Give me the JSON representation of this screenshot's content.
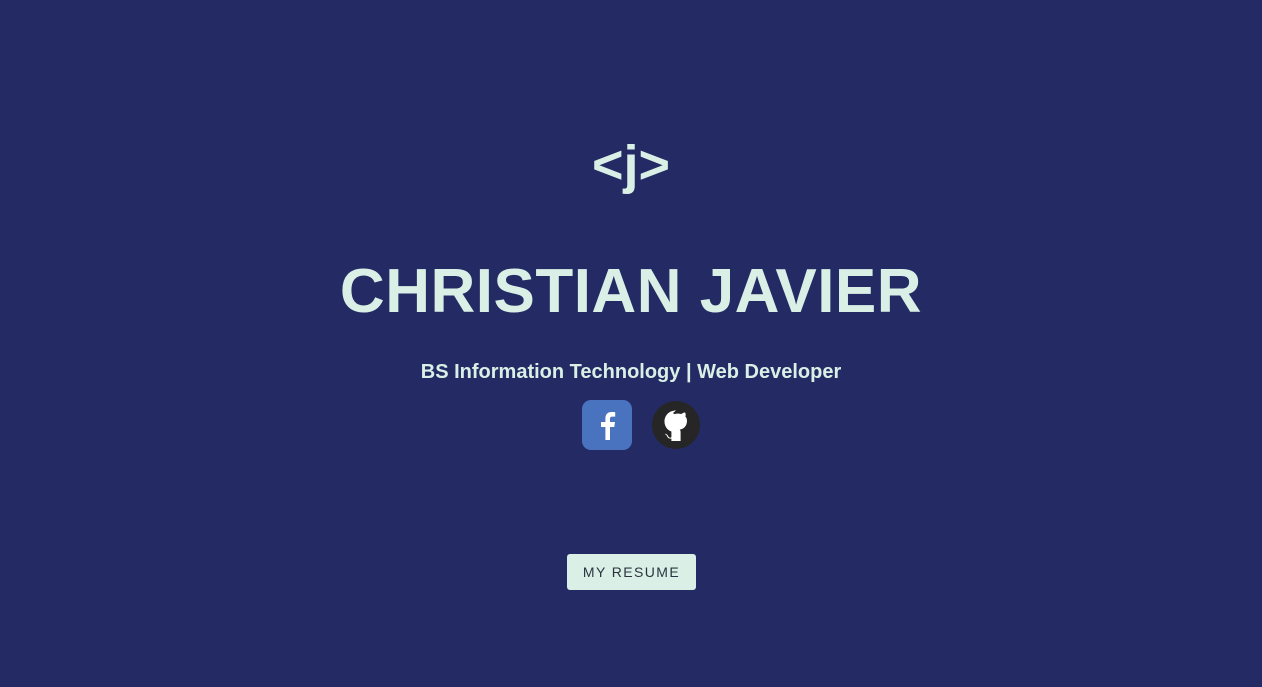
{
  "logo": {
    "text": "<j>"
  },
  "hero": {
    "name": "CHRISTIAN JAVIER",
    "subtitle": "BS Information Technology | Web Developer"
  },
  "socials": [
    {
      "name": "facebook",
      "icon": "facebook-icon",
      "color": "#4a73bf"
    },
    {
      "name": "github",
      "icon": "github-icon",
      "color": "#262626"
    }
  ],
  "cta": {
    "resume_label": "MY RESUME"
  },
  "colors": {
    "background": "#242b64",
    "accent": "#daf0e6"
  }
}
